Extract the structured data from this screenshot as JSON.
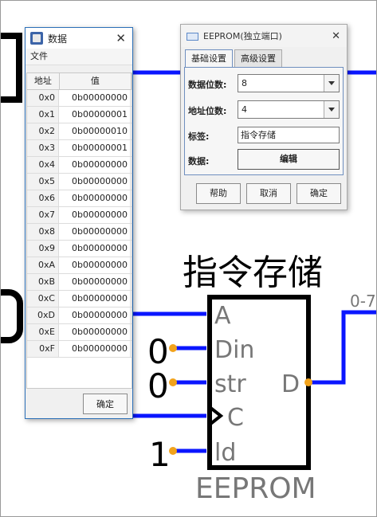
{
  "circuit": {
    "component_label": "指令存储",
    "component_type": "EEPROM",
    "pins": {
      "a": "A",
      "din": "Din",
      "str": "str",
      "c": "C",
      "ld": "ld",
      "d": "D"
    },
    "constants": {
      "din": "0",
      "str": "0",
      "ld": "1"
    },
    "bus_label": "0-7",
    "colors": {
      "wire": "#0a16ff",
      "pin": "#f2a31b",
      "block": "#000000"
    }
  },
  "data_window": {
    "title": "数据",
    "menu": [
      "文件"
    ],
    "columns": [
      "地址",
      "值"
    ],
    "rows": [
      {
        "addr": "0x0",
        "value": "0b00000000"
      },
      {
        "addr": "0x1",
        "value": "0b00000001"
      },
      {
        "addr": "0x2",
        "value": "0b00000010"
      },
      {
        "addr": "0x3",
        "value": "0b00000001"
      },
      {
        "addr": "0x4",
        "value": "0b00000000"
      },
      {
        "addr": "0x5",
        "value": "0b00000000"
      },
      {
        "addr": "0x6",
        "value": "0b00000000"
      },
      {
        "addr": "0x7",
        "value": "0b00000000"
      },
      {
        "addr": "0x8",
        "value": "0b00000000"
      },
      {
        "addr": "0x9",
        "value": "0b00000000"
      },
      {
        "addr": "0xA",
        "value": "0b00000000"
      },
      {
        "addr": "0xB",
        "value": "0b00000000"
      },
      {
        "addr": "0xC",
        "value": "0b00000000"
      },
      {
        "addr": "0xD",
        "value": "0b00000000"
      },
      {
        "addr": "0xE",
        "value": "0b00000000"
      },
      {
        "addr": "0xF",
        "value": "0b00000000"
      }
    ],
    "ok_label": "确定"
  },
  "eeprom_window": {
    "title": "EEPROM(独立端口)",
    "tabs": [
      "基础设置",
      "高级设置"
    ],
    "fields": {
      "data_bits_label": "数据位数:",
      "data_bits_value": "8",
      "addr_bits_label": "地址位数:",
      "addr_bits_value": "4",
      "tag_label": "标签:",
      "tag_value": "指令存储",
      "data_label": "数据:",
      "edit_label": "编辑"
    },
    "buttons": {
      "help": "帮助",
      "cancel": "取消",
      "ok": "确定"
    }
  }
}
